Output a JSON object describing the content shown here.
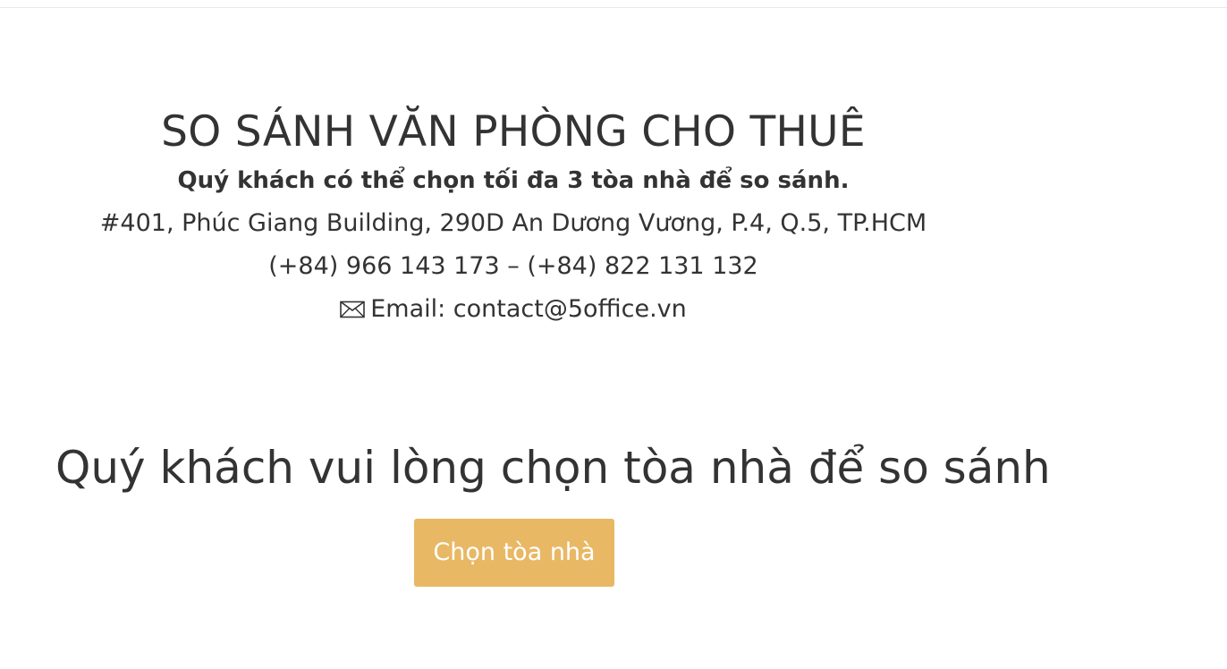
{
  "header": {
    "title": "SO SÁNH VĂN PHÒNG CHO THUÊ",
    "subtitle": "Quý khách có thể chọn tối đa 3 tòa nhà để so sánh.",
    "address": "#401, Phúc Giang Building, 290D An Dương Vương, P.4, Q.5, TP.HCM",
    "phone": "(+84) 966 143 173 – (+84) 822 131 132",
    "email_label": "Email: contact@5office.vn",
    "email_icon": "envelope-icon"
  },
  "main": {
    "heading": "Quý khách vui lòng chọn tòa nhà để so sánh",
    "select_button_label": "Chọn tòa nhà",
    "accent_color": "#e8b865"
  }
}
